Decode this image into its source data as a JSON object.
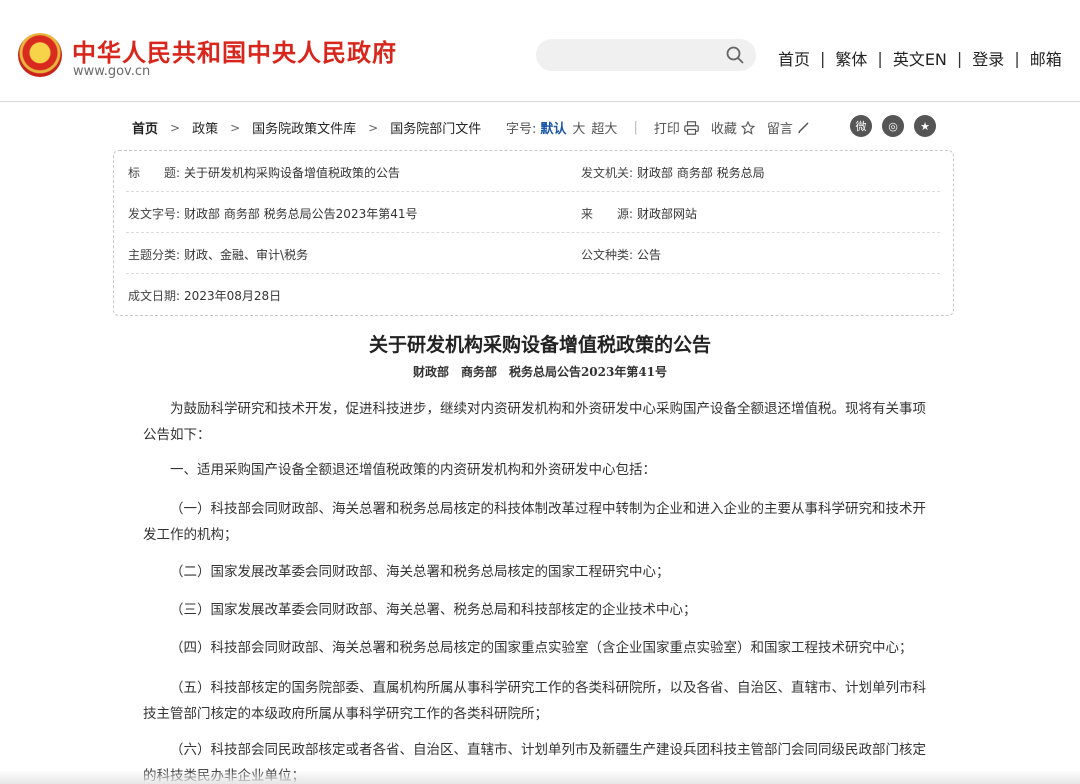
{
  "header": {
    "site_title": "中华人民共和国中央人民政府",
    "site_url": "www.gov.cn",
    "search_placeholder": "",
    "nav": [
      "首页",
      "繁体",
      "英文EN",
      "登录",
      "邮箱"
    ]
  },
  "breadcrumb": [
    "首页",
    "政策",
    "国务院政策文件库",
    "国务院部门文件"
  ],
  "tools": {
    "font_label": "字号:",
    "font_default": "默认",
    "font_large": "大",
    "font_xlarge": "超大",
    "print": "打印",
    "favorite": "收藏",
    "comment": "留言"
  },
  "info": {
    "title_label": "标　　题:",
    "title_value": "关于研发机构采购设备增值税政策的公告",
    "issuer_label": "发文机关:",
    "issuer_value": "财政部 商务部 税务总局",
    "docno_label": "发文字号:",
    "docno_value": "财政部 商务部 税务总局公告2023年第41号",
    "source_label": "来　　源:",
    "source_value": "财政部网站",
    "topic_label": "主题分类:",
    "topic_value": "财政、金融、审计\\税务",
    "type_label": "公文种类:",
    "type_value": "公告",
    "date_label": "成文日期:",
    "date_value": "2023年08月28日"
  },
  "article": {
    "title": "关于研发机构采购设备增值税政策的公告",
    "docno": "财政部　商务部　税务总局公告2023年第41号",
    "paragraphs": [
      "为鼓励科学研究和技术开发，促进科技进步，继续对内资研发机构和外资研发中心采购国产设备全额退还增值税。现将有关事项公告如下：",
      "一、适用采购国产设备全额退还增值税政策的内资研发机构和外资研发中心包括：",
      "（一）科技部会同财政部、海关总署和税务总局核定的科技体制改革过程中转制为企业和进入企业的主要从事科学研究和技术开发工作的机构；",
      "（二）国家发展改革委会同财政部、海关总署和税务总局核定的国家工程研究中心；",
      "（三）国家发展改革委会同财政部、海关总署、税务总局和科技部核定的企业技术中心；",
      "（四）科技部会同财政部、海关总署和税务总局核定的国家重点实验室（含企业国家重点实验室）和国家工程技术研究中心；",
      "（五）科技部核定的国务院部委、直属机构所属从事科学研究工作的各类科研院所，以及各省、自治区、直辖市、计划单列市科技主管部门核定的本级政府所属从事科学研究工作的各类科研院所；",
      "（六）科技部会同民政部核定或者各省、自治区、直辖市、计划单列市及新疆生产建设兵团科技主管部门会同同级民政部门核定的科技类民办非企业单位；"
    ]
  }
}
